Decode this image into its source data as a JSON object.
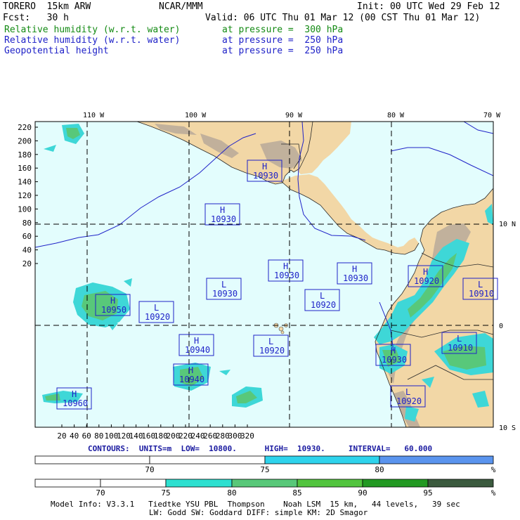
{
  "header": {
    "line1_left": "TORERO  15km ARW",
    "line1_mid": "NCAR/MMM",
    "line1_right": "Init: 00 UTC Wed 29 Feb 12",
    "line2_left": "Fcst:   30 h",
    "line2_right": "Valid: 06 UTC Thu 01 Mar 12 (00 CST Thu 01 Mar 12)",
    "fields": [
      {
        "name": "Relative humidity (w.r.t. water)",
        "level": "at pressure =  300 hPa",
        "color": "#138a13"
      },
      {
        "name": "Relative humidity (w.r.t. water)",
        "level": "at pressure =  250 hPa",
        "color": "#1f22c8"
      },
      {
        "name": "Geopotential height",
        "level": "at pressure =  250 hPa",
        "color": "#1f22c8"
      }
    ]
  },
  "map": {
    "top_lon_labels": [
      "110 W",
      "100 W",
      "90 W",
      "80 W",
      "70 W"
    ],
    "right_lat_labels": [
      "10 N",
      "0",
      "10 S"
    ],
    "left_ticks": [
      "220",
      "200",
      "180",
      "160",
      "140",
      "120",
      "100",
      "80",
      "60",
      "40",
      "20"
    ],
    "bottom_ticks": [
      "20",
      "40",
      "60",
      "80",
      "100",
      "120",
      "140",
      "160",
      "180",
      "200",
      "220",
      "240",
      "260",
      "280",
      "300",
      "320"
    ],
    "centers": [
      {
        "type": "H",
        "value": "10930"
      },
      {
        "type": "H",
        "value": "10930"
      },
      {
        "type": "H",
        "value": "10930"
      },
      {
        "type": "H",
        "value": "10930"
      },
      {
        "type": "H",
        "value": "10920"
      },
      {
        "type": "L",
        "value": "10910"
      },
      {
        "type": "H",
        "value": "10950"
      },
      {
        "type": "L",
        "value": "10920"
      },
      {
        "type": "L",
        "value": "10930"
      },
      {
        "type": "L",
        "value": "10920"
      },
      {
        "type": "H",
        "value": "10940"
      },
      {
        "type": "L",
        "value": "10920"
      },
      {
        "type": "H",
        "value": "10930"
      },
      {
        "type": "L",
        "value": "10910"
      },
      {
        "type": "H",
        "value": "10940"
      },
      {
        "type": "H",
        "value": "10960"
      },
      {
        "type": "L",
        "value": "10920"
      }
    ],
    "colors": {
      "ocean": "#e3fdfd",
      "land": "#f2d7a6",
      "terrain": "#b9aa9a",
      "rh_light": "#3ed7d7",
      "rh_green": "#58c87a",
      "contour": "#1f22c8"
    }
  },
  "contour_info": "CONTOURS:  UNITS=m  LOW=  10800.      HIGH=  10930.     INTERVAL=   60.000",
  "colorbar1": {
    "labels": [
      "70",
      "75",
      "80"
    ],
    "unit": "%",
    "colors": [
      "#ffffff",
      "#ffffff",
      "#2ed3ec",
      "#5a94ee"
    ]
  },
  "colorbar2": {
    "labels": [
      "70",
      "75",
      "80",
      "85",
      "90",
      "95"
    ],
    "unit": "%",
    "colors": [
      "#ffffff",
      "#ffffff",
      "#2de0d0",
      "#58c879",
      "#52c43e",
      "#229922",
      "#3b5a3e"
    ]
  },
  "footer": {
    "line1": "Model Info: V3.3.1   Tiedtke YSU PBL  Thompson    Noah LSM  15 km,   44 levels,   39 sec",
    "line2": "LW: Godd SW: Goddard DIFF: simple KM: 2D Smagor"
  }
}
